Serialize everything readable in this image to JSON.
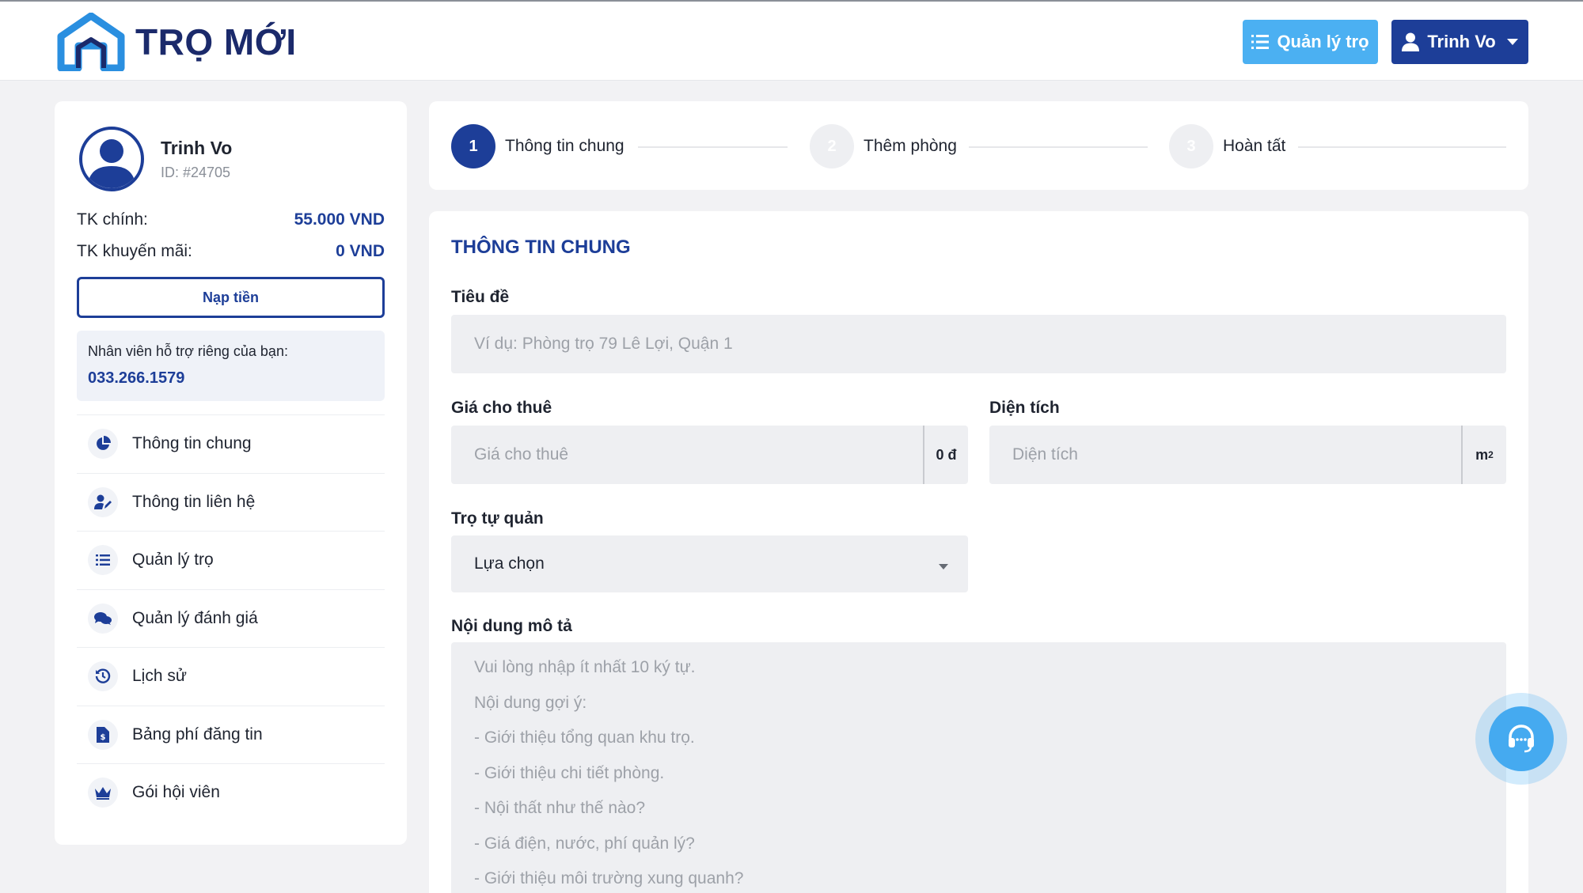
{
  "header": {
    "brand": "TRỌ MỚI",
    "manage_button": "Quản lý trọ",
    "user_button": "Trinh Vo"
  },
  "profile": {
    "name": "Trinh Vo",
    "id": "ID: #24705",
    "main_account_label": "TK chính:",
    "main_account_value": "55.000 VND",
    "promo_account_label": "TK khuyến mãi:",
    "promo_account_value": "0 VND",
    "topup_button": "Nạp tiền",
    "support_label": "Nhân viên hỗ trợ riêng của bạn:",
    "support_phone": "033.266.1579"
  },
  "sidebar": {
    "items": [
      {
        "label": "Thông tin chung",
        "icon": "pie-chart-icon"
      },
      {
        "label": "Thông tin liên hệ",
        "icon": "user-edit-icon"
      },
      {
        "label": "Quản lý trọ",
        "icon": "list-icon"
      },
      {
        "label": "Quản lý đánh giá",
        "icon": "comments-icon"
      },
      {
        "label": "Lịch sử",
        "icon": "history-icon"
      },
      {
        "label": "Bảng phí đăng tin",
        "icon": "invoice-icon"
      },
      {
        "label": "Gói hội viên",
        "icon": "crown-icon"
      }
    ]
  },
  "stepper": {
    "steps": [
      {
        "number": "1",
        "label": "Thông tin chung",
        "active": true
      },
      {
        "number": "2",
        "label": "Thêm phòng",
        "active": false
      },
      {
        "number": "3",
        "label": "Hoàn tất",
        "active": false
      }
    ]
  },
  "form": {
    "title": "THÔNG TIN CHUNG",
    "title_field": {
      "label": "Tiêu đề",
      "placeholder": "Ví dụ: Phòng trọ 79 Lê Lợi, Quận 1"
    },
    "price_field": {
      "label": "Giá cho thuê",
      "placeholder": "Giá cho thuê",
      "suffix": "0 đ"
    },
    "area_field": {
      "label": "Diện tích",
      "placeholder": "Diện tích",
      "suffix": "m",
      "suffix_sup": "2"
    },
    "self_managed_field": {
      "label": "Trọ tự quản",
      "value": "Lựa chọn"
    },
    "description_field": {
      "label": "Nội dung mô tả",
      "placeholder_lines": [
        "Vui lòng nhập ít nhất 10 ký tự.",
        "Nội dung gợi ý:",
        "- Giới thiệu tổng quan khu trọ.",
        "- Giới thiệu chi tiết phòng.",
        "- Nội thất như thế nào?",
        "- Giá điện, nước, phí quản lý?",
        "- Giới thiệu môi trường xung quanh?"
      ]
    }
  },
  "colors": {
    "primary": "#1d3e98",
    "accent": "#4bb0f2",
    "background": "#f2f2f4",
    "input_bg": "#eeeff2"
  }
}
